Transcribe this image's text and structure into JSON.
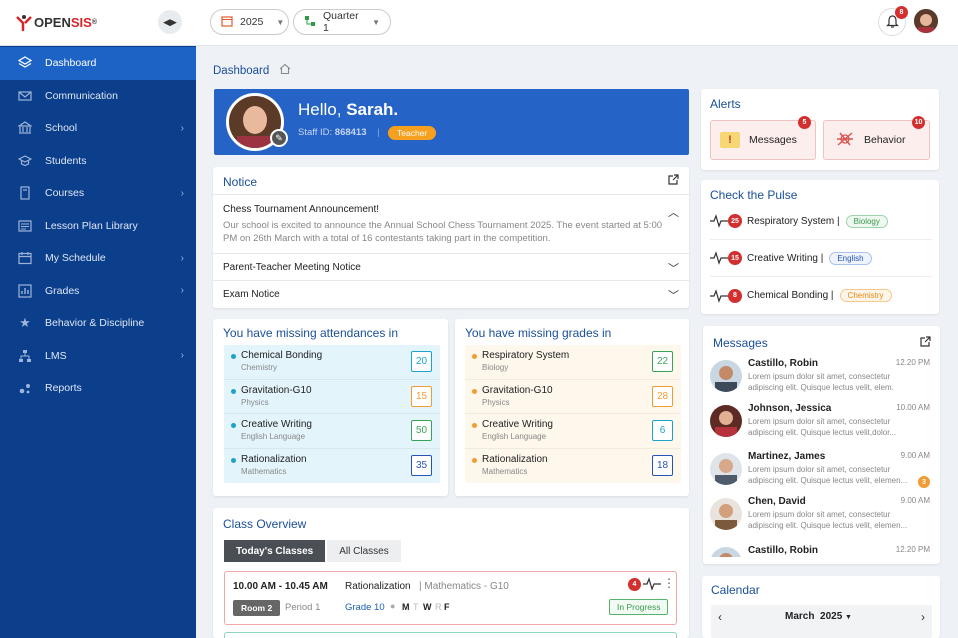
{
  "brand": {
    "logo_prefix": "OPEN",
    "logo_suffix": "SIS",
    "logo_mark": "®"
  },
  "sidebar": {
    "items": [
      {
        "label": "Dashboard",
        "icon": "layers-icon"
      },
      {
        "label": "Communication",
        "icon": "mail-icon"
      },
      {
        "label": "School",
        "icon": "bank-icon"
      },
      {
        "label": "Students",
        "icon": "graduation-cap-icon"
      },
      {
        "label": "Courses",
        "icon": "book-icon"
      },
      {
        "label": "Lesson Plan Library",
        "icon": "list-board-icon"
      },
      {
        "label": "My Schedule",
        "icon": "calendar-icon"
      },
      {
        "label": "Grades",
        "icon": "bar-chart-icon"
      },
      {
        "label": "Behavior & Discipline",
        "icon": "star-icon"
      },
      {
        "label": "LMS",
        "icon": "hierarchy-icon"
      },
      {
        "label": "Reports",
        "icon": "dots-icon"
      }
    ]
  },
  "topbar": {
    "year": "2025",
    "quarter": "Quarter 1",
    "notifications": "8"
  },
  "breadcrumb": {
    "current": "Dashboard"
  },
  "hello": {
    "greeting": "Hello, ",
    "name": "Sarah.",
    "staff_label": "Staff ID:",
    "staff_id": "868413",
    "role": "Teacher"
  },
  "notice": {
    "title": "Notice",
    "items": [
      {
        "title": "Chess Tournament Announcement!",
        "body": "Our school is excited to announce the Annual School Chess Tournament 2025. The event started at 5:00 PM on 26th March with a total of 16 contestants taking part in the competition."
      },
      {
        "title": "Parent-Teacher Meeting Notice"
      },
      {
        "title": "Exam Notice"
      }
    ]
  },
  "missing_attendance": {
    "title": "You have missing attendances in",
    "items": [
      {
        "name": "Chemical Bonding",
        "sub": "Chemistry",
        "count": "20"
      },
      {
        "name": "Gravitation-G10",
        "sub": "Physics",
        "count": "15"
      },
      {
        "name": "Creative Writing",
        "sub": "English Language",
        "count": "50"
      },
      {
        "name": "Rationalization",
        "sub": "Mathematics",
        "count": "35"
      }
    ]
  },
  "missing_grades": {
    "title": "You have missing grades in",
    "items": [
      {
        "name": "Respiratory System",
        "sub": "Biology",
        "count": "22"
      },
      {
        "name": "Gravitation-G10",
        "sub": "Physics",
        "count": "28"
      },
      {
        "name": "Creative Writing",
        "sub": "English Language",
        "count": "6"
      },
      {
        "name": "Rationalization",
        "sub": "Mathematics",
        "count": "18"
      }
    ]
  },
  "class_overview": {
    "title": "Class Overview",
    "tabs": [
      "Today's Classes",
      "All Classes"
    ],
    "entry": {
      "time": "10.00 AM - 10.45 AM",
      "course": "Rationalization",
      "subject": "| Mathematics - G10",
      "room": "Room 2",
      "period": "Period 1",
      "grade": "Grade 10",
      "days": [
        "M",
        "T",
        "W",
        "R",
        "F"
      ],
      "alerts": "4",
      "status": "In Progress"
    }
  },
  "alerts": {
    "title": "Alerts",
    "messages_label": "Messages",
    "messages_count": "5",
    "behavior_label": "Behavior",
    "behavior_count": "10"
  },
  "pulse": {
    "title": "Check the Pulse",
    "items": [
      {
        "count": "25",
        "name": "Respiratory System |",
        "tag": "Biology"
      },
      {
        "count": "15",
        "name": "Creative Writing |",
        "tag": "English"
      },
      {
        "count": "8",
        "name": "Chemical Bonding |",
        "tag": "Chemistry"
      }
    ]
  },
  "messages": {
    "title": "Messages",
    "items": [
      {
        "name": "Castillo, Robin",
        "time": "12.20 PM",
        "text": "Lorem ipsum dolor sit amet, consectetur adipiscing elit. Quisque lectus velit, elem."
      },
      {
        "name": "Johnson, Jessica",
        "time": "10.00 AM",
        "text": "Lorem ipsum dolor sit amet, consectetur adipiscing elit. Quisque lectus velit,dolor..."
      },
      {
        "name": "Martinez, James",
        "time": "9.00 AM",
        "text": "Lorem ipsum dolor sit amet, consectetur adipiscing elit. Quisque lectus velit, elemen...",
        "unread": "3"
      },
      {
        "name": "Chen, David",
        "time": "9.00 AM",
        "text": "Lorem ipsum dolor sit amet, consectetur adipiscing elit. Quisque lectus velit, elemen..."
      },
      {
        "name": "Castillo, Robin",
        "time": "12.20 PM"
      }
    ]
  },
  "calendar": {
    "title": "Calendar",
    "month": "March",
    "year": "2025"
  }
}
